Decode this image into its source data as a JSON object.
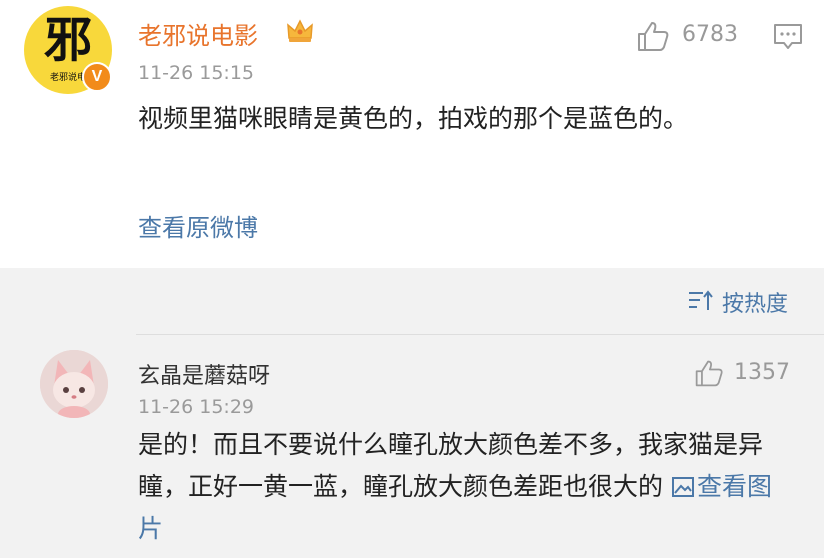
{
  "post": {
    "author": "老邪说电影",
    "avatar_char": "邪",
    "avatar_sub": "老邪说电",
    "verified_mark": "V",
    "time": "11-26 15:15",
    "like_count": "6783",
    "text": "视频里猫咪眼睛是黄色的，拍戏的那个是蓝色的。",
    "view_original": "查看原微博",
    "colors": {
      "author": "#e8742c",
      "link": "#4b78a8",
      "badge": "#f28b1a"
    },
    "icons": [
      "crown-icon",
      "thumbs-up-icon",
      "comment-icon"
    ]
  },
  "sort": {
    "label": "按热度",
    "icon": "sort-icon"
  },
  "comment": {
    "author": "玄晶是蘑菇呀",
    "time": "11-26 15:29",
    "like_count": "1357",
    "text": "是的！而且不要说什么瞳孔放大颜色差不多，我家猫是异瞳，正好一黄一蓝，瞳孔放大颜色差距也很大的",
    "view_image": "查看图片",
    "icons": [
      "thumbs-up-icon",
      "image-icon"
    ]
  }
}
